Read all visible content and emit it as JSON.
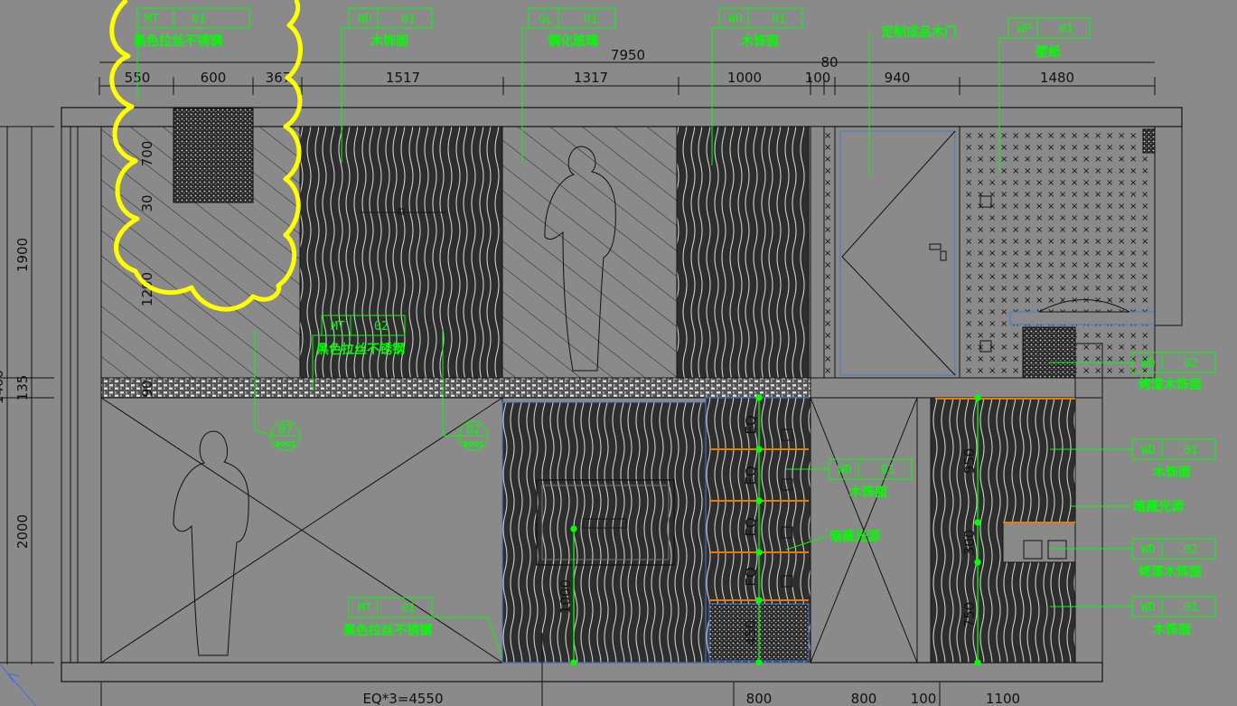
{
  "drawing": {
    "overall_width": "7950",
    "bottom_dims": [
      "EQ*3=4550",
      "800",
      "800",
      "100",
      "1100"
    ],
    "top_dims": [
      "550",
      "600",
      "367",
      "1517",
      "1317",
      "1000",
      "100",
      "80",
      "940",
      "1480"
    ],
    "left_dims": [
      "1900",
      "135",
      "2000",
      "1400"
    ],
    "inner_dims": {
      "d700": "700",
      "d30": "30",
      "d1200": "1200",
      "d90": "90",
      "d1000": "1000",
      "d450": "450",
      "d950": "950",
      "d300": "300",
      "d750": "750",
      "eq": "EQ",
      "eq30": "30"
    }
  },
  "tags": {
    "mt01_top": {
      "code": "MT",
      "num": "01",
      "label": "黑色拉丝不锈钢"
    },
    "wd01_top": {
      "code": "WD",
      "num": "01",
      "label": "木饰面"
    },
    "gl01_top": {
      "code": "GL",
      "num": "01",
      "label": "钢化玻璃"
    },
    "wd01_top2": {
      "code": "WD",
      "num": "01",
      "label": "木饰面"
    },
    "door_top": {
      "label": "定制成品木门"
    },
    "wp01_top": {
      "code": "WP",
      "num": "01",
      "label": "壁纸"
    },
    "mt02_mid": {
      "code": "MT",
      "num": "02",
      "label": "黑色拉丝不锈钢"
    },
    "mt01_bot": {
      "code": "MT",
      "num": "01",
      "label": "黑色拉丝不锈钢"
    },
    "wd01_mid": {
      "code": "WD",
      "num": "01",
      "label": "木饰面"
    },
    "led_mid": {
      "label": "暗藏光源"
    },
    "wd02_r1": {
      "code": "WD",
      "num": "02",
      "label": "烤漆木饰面"
    },
    "wd01_r2": {
      "code": "WD",
      "num": "01",
      "label": "木饰面"
    },
    "led_r3": {
      "label": "暗藏光源"
    },
    "wd02_r4": {
      "code": "WD",
      "num": "02",
      "label": "烤漆木饰面"
    },
    "wd01_r5": {
      "code": "WD",
      "num": "01",
      "label": "木饰面"
    }
  },
  "detail_refs": [
    {
      "num": "07",
      "sheet": "B001"
    },
    {
      "num": "02",
      "sheet": "B001"
    }
  ],
  "colors": {
    "background": "#8a8a8a",
    "linework": "#111111",
    "annotation": "#00ff00",
    "revision_cloud": "#ffff00",
    "orange_strip": "#e87a00",
    "blue_line": "#4a76d0"
  }
}
